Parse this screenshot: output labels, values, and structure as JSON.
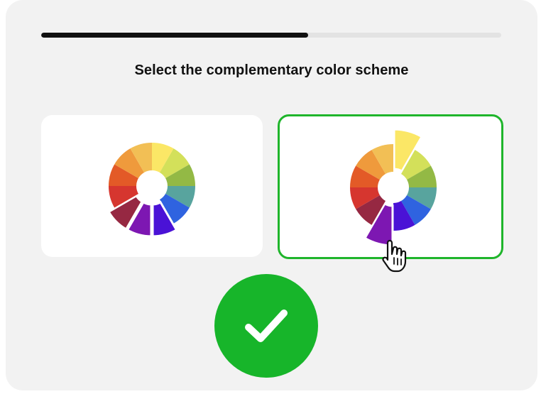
{
  "quiz": {
    "progress": 0.58,
    "question": "Select the complementary color scheme",
    "selected_option": "option-b",
    "result": "correct"
  },
  "colors": {
    "background_card": "#f2f2f2",
    "progress_track": "#e3e3e3",
    "progress_fill": "#111111",
    "selected_border": "#1fb52b",
    "success": "#17b52a"
  },
  "options": [
    {
      "id": "option-a",
      "highlighted_segments": [
        "crimson",
        "purple",
        "violet"
      ]
    },
    {
      "id": "option-b",
      "highlighted_segments": [
        "yellow",
        "purple"
      ]
    }
  ],
  "wheel_segments": [
    {
      "name": "yellow",
      "color": "#fbe766"
    },
    {
      "name": "yellow-green",
      "color": "#d3e05a"
    },
    {
      "name": "green",
      "color": "#93b945"
    },
    {
      "name": "teal",
      "color": "#58a49e"
    },
    {
      "name": "blue",
      "color": "#2f63e0"
    },
    {
      "name": "violet",
      "color": "#4a12d6"
    },
    {
      "name": "purple",
      "color": "#7d17b2"
    },
    {
      "name": "crimson",
      "color": "#962842"
    },
    {
      "name": "red",
      "color": "#d6362f"
    },
    {
      "name": "red-orange",
      "color": "#e35a27"
    },
    {
      "name": "orange",
      "color": "#ef9a3c"
    },
    {
      "name": "yellow-orange",
      "color": "#f2bf55"
    }
  ],
  "icons": {
    "cursor": "hand-pointer-icon",
    "success": "checkmark-icon"
  }
}
